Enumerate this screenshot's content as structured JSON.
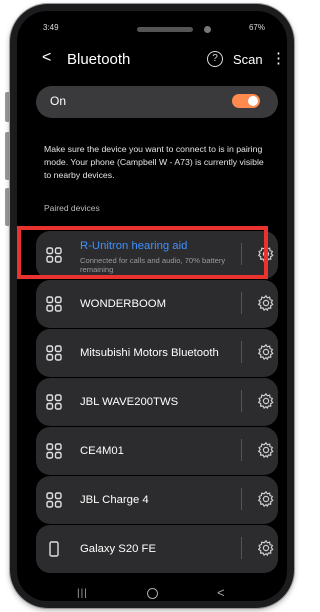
{
  "status": {
    "time": "3:49",
    "right": "67%"
  },
  "header": {
    "back": "<",
    "title": "Bluetooth",
    "help": "?",
    "scan": "Scan",
    "more": "⋮"
  },
  "bluetooth": {
    "label": "On",
    "state": "on",
    "accent": "#ff8a50"
  },
  "info": "Make sure the device you want to connect to is in pairing mode. Your phone (Campbell W - A73) is currently visible to nearby devices.",
  "section_label": "Paired devices",
  "devices": [
    {
      "name": "R-Unitron hearing aid",
      "status": "Connected for calls and audio, 70% battery remaining",
      "icon": "device-grid-icon",
      "connected": true
    },
    {
      "name": "WONDERBOOM",
      "icon": "device-grid-icon"
    },
    {
      "name": "Mitsubishi Motors Bluetooth",
      "icon": "device-grid-icon"
    },
    {
      "name": "JBL WAVE200TWS",
      "icon": "device-grid-icon"
    },
    {
      "name": "CE4M01",
      "icon": "device-grid-icon"
    },
    {
      "name": "JBL Charge 4",
      "icon": "device-grid-icon"
    },
    {
      "name": "Galaxy S20 FE",
      "icon": "phone-icon"
    }
  ],
  "colors": {
    "connected_text": "#3e91ff",
    "highlight": "#e8332e"
  },
  "navbar": {
    "recent": "|||",
    "back": "<"
  }
}
